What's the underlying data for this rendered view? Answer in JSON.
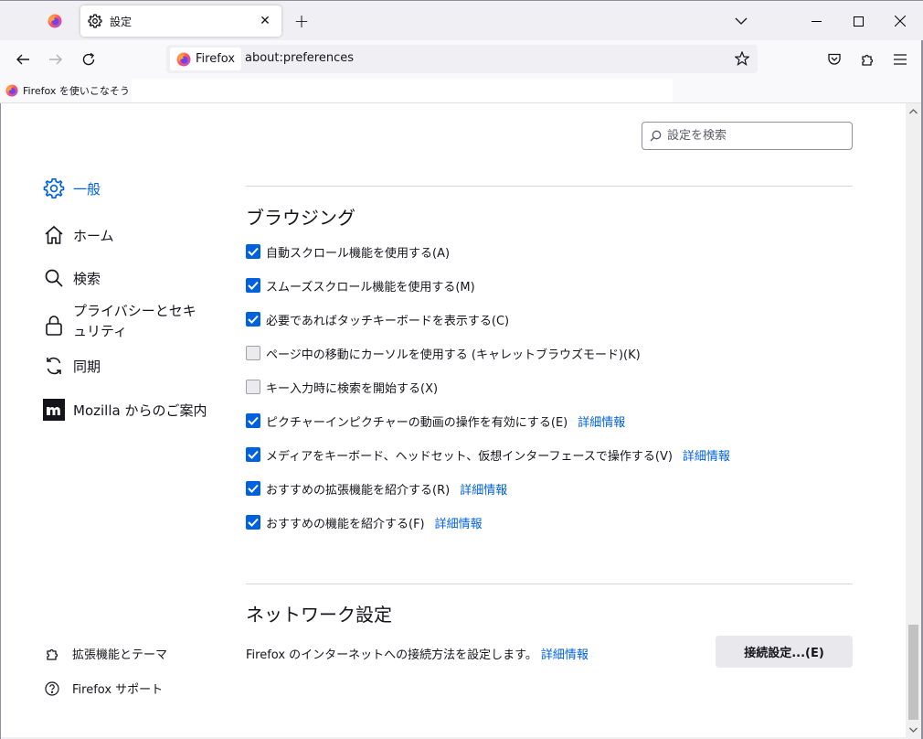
{
  "tabs": {
    "active_title": "設定",
    "close_symbol": "✕",
    "new_tab_symbol": "+"
  },
  "navbar": {
    "identity_label": "Firefox",
    "url": "about:preferences"
  },
  "bookmarks": {
    "items": [
      {
        "label": "Firefox を使いこなそう"
      }
    ]
  },
  "search": {
    "placeholder": "設定を検索"
  },
  "sidebar": {
    "categories": [
      {
        "label": "一般",
        "icon": "gear-icon",
        "selected": true
      },
      {
        "label": "ホーム",
        "icon": "home-icon"
      },
      {
        "label": "検索",
        "icon": "search-icon"
      },
      {
        "label": "プライバシーとセキュリティ",
        "icon": "lock-icon"
      },
      {
        "label": "同期",
        "icon": "sync-icon"
      },
      {
        "label": "Mozilla からのご案内",
        "icon": "mozilla-icon"
      }
    ],
    "footer": [
      {
        "label": "拡張機能とテーマ",
        "icon": "puzzle-icon"
      },
      {
        "label": "Firefox サポート",
        "icon": "help-icon"
      }
    ]
  },
  "browsing": {
    "heading": "ブラウジング",
    "options": [
      {
        "label": "自動スクロール機能を使用する(A)",
        "checked": true
      },
      {
        "label": "スムーズスクロール機能を使用する(M)",
        "checked": true
      },
      {
        "label": "必要であればタッチキーボードを表示する(C)",
        "checked": true
      },
      {
        "label": "ページ中の移動にカーソルを使用する (キャレットブラウズモード)(K)",
        "checked": false
      },
      {
        "label": "キー入力時に検索を開始する(X)",
        "checked": false
      },
      {
        "label": "ピクチャーインピクチャーの動画の操作を有効にする(E)",
        "checked": true,
        "learn_more": "詳細情報"
      },
      {
        "label": "メディアをキーボード、ヘッドセット、仮想インターフェースで操作する(V)",
        "checked": true,
        "learn_more": "詳細情報"
      },
      {
        "label": "おすすめの拡張機能を紹介する(R)",
        "checked": true,
        "learn_more": "詳細情報"
      },
      {
        "label": "おすすめの機能を紹介する(F)",
        "checked": true,
        "learn_more": "詳細情報"
      }
    ]
  },
  "network": {
    "heading": "ネットワーク設定",
    "description": "Firefox のインターネットへの接続方法を設定します。",
    "learn_more": "詳細情報",
    "button_label": "接続設定...(E)"
  },
  "colors": {
    "accent": "#0061e0"
  }
}
